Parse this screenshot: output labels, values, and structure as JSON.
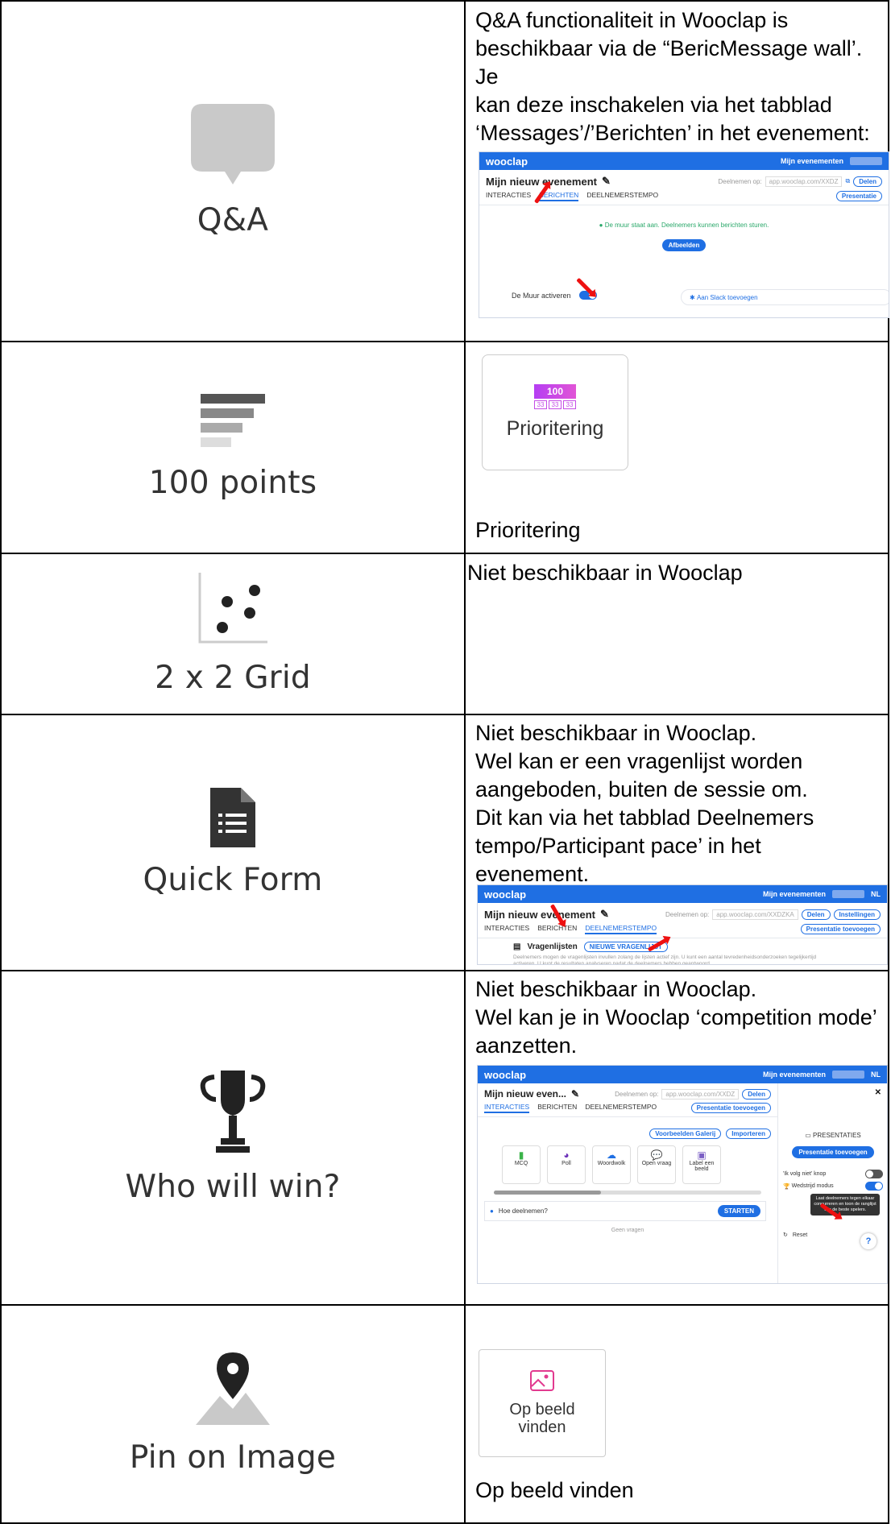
{
  "rows": [
    {
      "feature": "Q&A",
      "text": [
        "Q&A functionaliteit in Wooclap is",
        "beschikbaar via de “BericMessage wall’. Je",
        "kan deze inschakelen via het tabblad",
        "‘Messages’/’Berichten’ in het evenement:"
      ],
      "shot": {
        "brand": "wooclap",
        "menu": "Mijn evenementen",
        "event_title": "Mijn nieuw evenement",
        "participate": "Deelnemen op:",
        "url": "app.wooclap.com/XXDZ",
        "share": "Delen",
        "tabs": [
          "INTERACTIES",
          "BERICHTEN",
          "DEELNEMERSTEMPO"
        ],
        "presentatie": "Presentatie",
        "status": "De muur staat aan. Deelnemers kunnen berichten sturen.",
        "afbeelden": "Afbeelden",
        "activate": "De Muur activeren",
        "slack": "Aan Slack toevoegen"
      }
    },
    {
      "feature": "100 points",
      "tile": {
        "badge": "100",
        "cells": [
          "33",
          "33",
          "33"
        ],
        "label": "Prioritering"
      },
      "caption": "Prioritering"
    },
    {
      "feature": "2 x 2 Grid",
      "text": [
        "Niet beschikbaar in Wooclap"
      ]
    },
    {
      "feature": "Quick Form",
      "text": [
        "Niet beschikbaar in Wooclap.",
        "Wel kan er een vragenlijst worden",
        "aangeboden, buiten de sessie om.",
        "Dit kan via het tabblad Deelnemers",
        "tempo/Participant pace’ in het",
        "evenement."
      ],
      "shot": {
        "brand": "wooclap",
        "menu": "Mijn evenementen",
        "lang": "NL",
        "event_title": "Mijn nieuw evenement",
        "participate": "Deelnemen op:",
        "url": "app.wooclap.com/XXDZKA",
        "share": "Delen",
        "settings": "Instellingen",
        "tabs": [
          "INTERACTIES",
          "BERICHTEN",
          "DEELNEMERSTEMPO"
        ],
        "add_presentation": "Presentatie toevoegen",
        "section": "Vragenlijsten",
        "new_btn": "NIEUWE VRAGENLIJST",
        "desc": "Deelnemers mogen de vragenlijsten invullen zolang de lijsten actief zijn. U kunt een aantal tevredenheidsonderzoeken tegelijkertijd activeren. U kunt de resultaten analyseren nadat de deelnemers hebben geantwoord."
      }
    },
    {
      "feature": "Who will win?",
      "text": [
        "Niet beschikbaar in Wooclap.",
        "Wel kan je in Wooclap ‘competition mode’",
        "aanzetten."
      ],
      "shot": {
        "brand": "wooclap",
        "menu": "Mijn evenementen",
        "lang": "NL",
        "event_title": "Mijn nieuw even...",
        "participate": "Deelnemen op:",
        "url": "app.wooclap.com/XXDZ",
        "share": "Delen",
        "tabs": [
          "INTERACTIES",
          "BERICHTEN",
          "DEELNEMERSTEMPO"
        ],
        "add_presentation": "Presentatie toevoegen",
        "gallery": "Voorbeelden Galerij",
        "import": "Importeren",
        "types": [
          "MCQ",
          "Poll",
          "Woordwolk",
          "Open vraag",
          "Label een beeld"
        ],
        "question": "Hoe deelnemen?",
        "start": "STARTEN",
        "no_questions": "Geen vragen",
        "side_title": "PRESENTATIES",
        "side_btn": "Presentatie toevoegen",
        "follow": "'Ik volg niet' knop",
        "competition": "Wedstrijd modus",
        "tooltip": "Laat deelnemers tegen elkaar concurreren en toon de ranglijst van de beste spelers.",
        "reset": "Reset",
        "help": "?"
      }
    },
    {
      "feature": "Pin on Image",
      "tile": {
        "label_line1": "Op beeld",
        "label_line2": "vinden"
      },
      "caption": "Op beeld vinden"
    }
  ]
}
